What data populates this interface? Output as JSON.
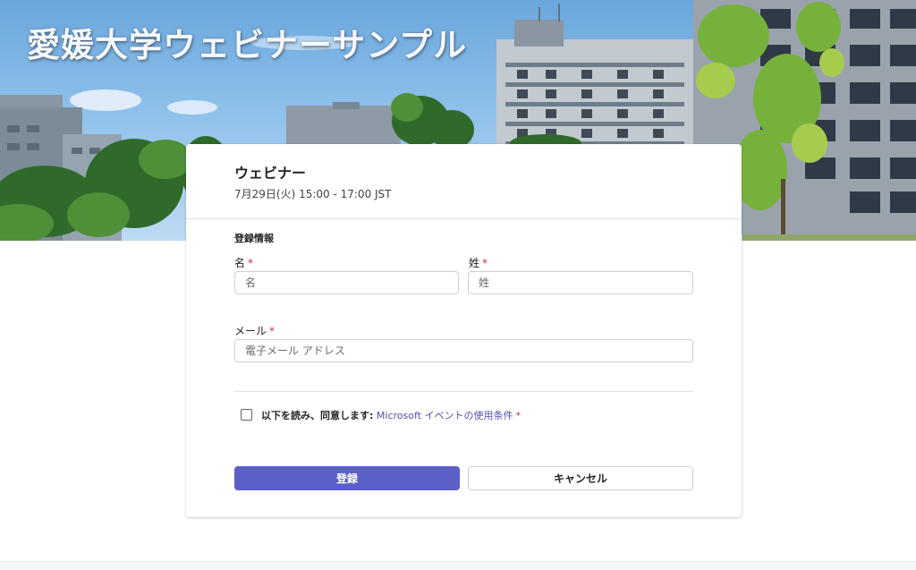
{
  "banner": {
    "title": "愛媛大学ウェビナーサンプル"
  },
  "event": {
    "title": "ウェビナー",
    "datetime": "7月29日(火) 15:00 - 17:00 JST"
  },
  "form": {
    "section_title": "登録情報",
    "required_mark": "*",
    "first_name": {
      "label": "名",
      "placeholder": "名",
      "value": ""
    },
    "last_name": {
      "label": "姓",
      "placeholder": "姓",
      "value": ""
    },
    "email": {
      "label": "メール",
      "placeholder": "電子メール アドレス",
      "value": ""
    },
    "terms": {
      "checked": false,
      "prefix": "以下を読み、同意します:",
      "link_text": "Microsoft イベントの使用条件"
    },
    "register_label": "登録",
    "cancel_label": "キャンセル"
  },
  "colors": {
    "accent": "#5b5fc7",
    "link": "#4f52b2",
    "required": "#c4314b"
  },
  "icons": [
    "checkbox-icon"
  ]
}
